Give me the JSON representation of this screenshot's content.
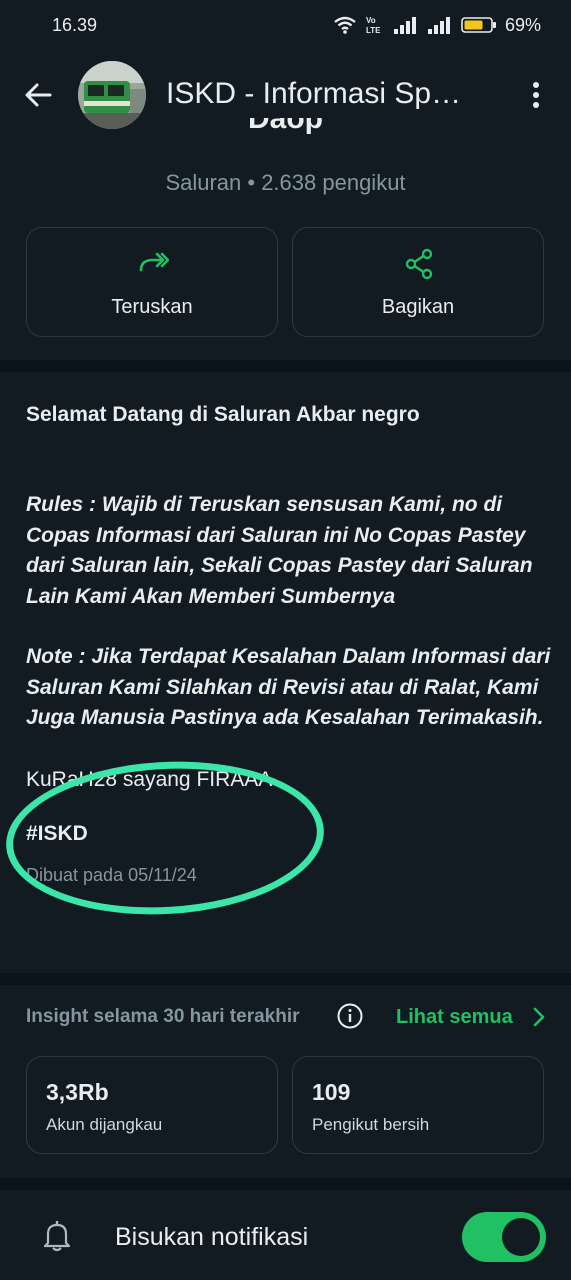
{
  "status_bar": {
    "time": "16.39",
    "battery": "69%",
    "icons": [
      "wifi-icon",
      "volte-icon",
      "signal-icon",
      "signal-icon",
      "battery-icon"
    ]
  },
  "app_bar": {
    "title": "ISKD - Informasi Sp…",
    "back_icon": "arrow-left-icon",
    "menu_icon": "more-vertical-icon"
  },
  "channel": {
    "partial_name": "Daop",
    "subtitle": "Saluran • 2.638 pengikut"
  },
  "actions": {
    "forward_label": "Teruskan",
    "share_label": "Bagikan"
  },
  "description": {
    "welcome": "Selamat Datang di Saluran Akbar negro",
    "rules": "Rules : Wajib di Teruskan sensusan Kami, no di Copas Informasi dari Saluran ini No Copas Pastey dari Saluran lain, Sekali Copas Pastey dari Saluran Lain Kami Akan Memberi Sumbernya",
    "note": "Note : Jika Terdapat Kesalahan Dalam Informasi dari Saluran Kami Silahkan di Revisi atau di Ralat, Kami Juga Manusia Pastinya ada Kesalahan Terimakasih.",
    "highlight": "KuRaH28 sayang FIRAAA",
    "hashtag": "#ISKD",
    "created": "Dibuat pada 05/11/24"
  },
  "insights": {
    "label": "Insight selama 30 hari terakhir",
    "see_all": "Lihat semua",
    "stats": [
      {
        "value": "3,3Rb",
        "label": "Akun dijangkau"
      },
      {
        "value": "109",
        "label": "Pengikut bersih"
      }
    ]
  },
  "notifications": {
    "label": "Bisukan notifikasi",
    "muted": true
  },
  "colors": {
    "background": "#111b21",
    "accent": "#21c063",
    "annotation": "#3be6a8",
    "muted_text": "#8696a0"
  }
}
